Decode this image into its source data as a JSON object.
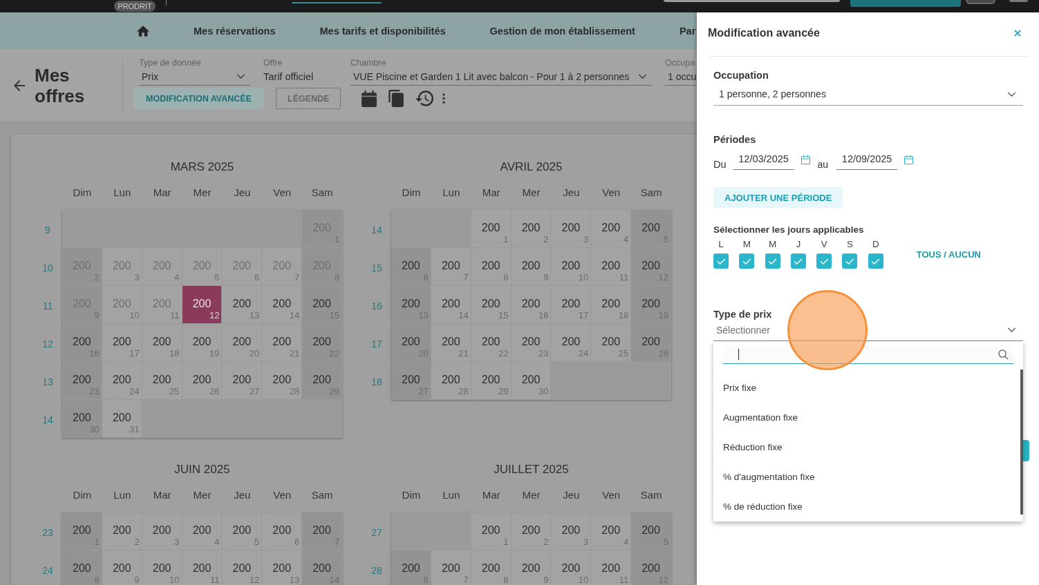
{
  "top_bar": {
    "badge": "PRODRIT"
  },
  "nav": {
    "items": [
      "Mes réservations",
      "Mes tarifs et disponibilités",
      "Gestion de mon établissement",
      "Par"
    ]
  },
  "header": {
    "title": "Mes offres",
    "filters": [
      {
        "kind": "select",
        "label": "Type de donnée",
        "value": "Prix"
      },
      {
        "kind": "text",
        "label": "Offre",
        "value": "Tarif officiel"
      },
      {
        "kind": "select",
        "label": "Chambre",
        "value": "VUE Piscine et Garden 1 Lit avec balcon - Pour 1 à 2 personnes"
      },
      {
        "kind": "partial",
        "label": "Occupa",
        "value": "1 occu"
      }
    ],
    "buttons": [
      {
        "kind": "tonal",
        "label": "MODIFICATION AVANCÉE"
      },
      {
        "kind": "outlined",
        "label": "LÉGENDE"
      }
    ]
  },
  "calendar": {
    "months": [
      {
        "title": "MARS 2025",
        "weekdays": [
          "Dim",
          "Lun",
          "Mar",
          "Mer",
          "Jeu",
          "Ven",
          "Sam"
        ],
        "weeks": [
          {
            "number": "9",
            "days": [
              {
                "kind": "blank"
              },
              {
                "kind": "blank"
              },
              {
                "kind": "blank"
              },
              {
                "kind": "blank"
              },
              {
                "kind": "blank"
              },
              {
                "kind": "blank"
              },
              {
                "kind": "day",
                "price": "200",
                "day": "1",
                "past": true,
                "today": false
              }
            ]
          },
          {
            "number": "10",
            "days": [
              {
                "kind": "day",
                "price": "200",
                "day": "2",
                "past": true,
                "today": false
              },
              {
                "kind": "day",
                "price": "200",
                "day": "3",
                "past": true,
                "today": false
              },
              {
                "kind": "day",
                "price": "200",
                "day": "4",
                "past": true,
                "today": false
              },
              {
                "kind": "day",
                "price": "200",
                "day": "5",
                "past": true,
                "today": false
              },
              {
                "kind": "day",
                "price": "200",
                "day": "6",
                "past": true,
                "today": false
              },
              {
                "kind": "day",
                "price": "200",
                "day": "7",
                "past": true,
                "today": false
              },
              {
                "kind": "day",
                "price": "200",
                "day": "8",
                "past": true,
                "today": false
              }
            ]
          },
          {
            "number": "11",
            "days": [
              {
                "kind": "day",
                "price": "200",
                "day": "9",
                "past": true,
                "today": false
              },
              {
                "kind": "day",
                "price": "200",
                "day": "10",
                "past": true,
                "today": false
              },
              {
                "kind": "day",
                "price": "200",
                "day": "11",
                "past": true,
                "today": false
              },
              {
                "kind": "day",
                "price": "200",
                "day": "12",
                "past": false,
                "today": true
              },
              {
                "kind": "day",
                "price": "200",
                "day": "13",
                "past": false,
                "today": false
              },
              {
                "kind": "day",
                "price": "200",
                "day": "14",
                "past": false,
                "today": false
              },
              {
                "kind": "day",
                "price": "200",
                "day": "15",
                "past": false,
                "today": false
              }
            ]
          },
          {
            "number": "12",
            "days": [
              {
                "kind": "day",
                "price": "200",
                "day": "16",
                "past": false,
                "today": false
              },
              {
                "kind": "day",
                "price": "200",
                "day": "17",
                "past": false,
                "today": false
              },
              {
                "kind": "day",
                "price": "200",
                "day": "18",
                "past": false,
                "today": false
              },
              {
                "kind": "day",
                "price": "200",
                "day": "19",
                "past": false,
                "today": false
              },
              {
                "kind": "day",
                "price": "200",
                "day": "20",
                "past": false,
                "today": false
              },
              {
                "kind": "day",
                "price": "200",
                "day": "21",
                "past": false,
                "today": false
              },
              {
                "kind": "day",
                "price": "200",
                "day": "22",
                "past": false,
                "today": false
              }
            ]
          },
          {
            "number": "13",
            "days": [
              {
                "kind": "day",
                "price": "200",
                "day": "23",
                "past": false,
                "today": false
              },
              {
                "kind": "day",
                "price": "200",
                "day": "24",
                "past": false,
                "today": false
              },
              {
                "kind": "day",
                "price": "200",
                "day": "25",
                "past": false,
                "today": false
              },
              {
                "kind": "day",
                "price": "200",
                "day": "26",
                "past": false,
                "today": false
              },
              {
                "kind": "day",
                "price": "200",
                "day": "27",
                "past": false,
                "today": false
              },
              {
                "kind": "day",
                "price": "200",
                "day": "28",
                "past": false,
                "today": false
              },
              {
                "kind": "day",
                "price": "200",
                "day": "29",
                "past": false,
                "today": false
              }
            ]
          },
          {
            "number": "14",
            "days": [
              {
                "kind": "day",
                "price": "200",
                "day": "30",
                "past": false,
                "today": false
              },
              {
                "kind": "day",
                "price": "200",
                "day": "31",
                "past": false,
                "today": false
              },
              {
                "kind": "blank"
              },
              {
                "kind": "blank"
              },
              {
                "kind": "blank"
              },
              {
                "kind": "blank"
              },
              {
                "kind": "blank"
              }
            ]
          }
        ]
      },
      {
        "title": "AVRIL 2025",
        "weekdays": [
          "Dim",
          "Lun",
          "Mar",
          "Mer",
          "Jeu",
          "Ven",
          "Sam"
        ],
        "weeks": [
          {
            "number": "14",
            "days": [
              {
                "kind": "blank"
              },
              {
                "kind": "blank"
              },
              {
                "kind": "day",
                "price": "200",
                "day": "1",
                "past": false,
                "today": false
              },
              {
                "kind": "day",
                "price": "200",
                "day": "2",
                "past": false,
                "today": false
              },
              {
                "kind": "day",
                "price": "200",
                "day": "3",
                "past": false,
                "today": false
              },
              {
                "kind": "day",
                "price": "200",
                "day": "4",
                "past": false,
                "today": false
              },
              {
                "kind": "day",
                "price": "200",
                "day": "5",
                "past": false,
                "today": false
              }
            ]
          },
          {
            "number": "15",
            "days": [
              {
                "kind": "day",
                "price": "200",
                "day": "6",
                "past": false,
                "today": false
              },
              {
                "kind": "day",
                "price": "200",
                "day": "7",
                "past": false,
                "today": false
              },
              {
                "kind": "day",
                "price": "200",
                "day": "8",
                "past": false,
                "today": false
              },
              {
                "kind": "day",
                "price": "200",
                "day": "9",
                "past": false,
                "today": false
              },
              {
                "kind": "day",
                "price": "200",
                "day": "10",
                "past": false,
                "today": false
              },
              {
                "kind": "day",
                "price": "200",
                "day": "11",
                "past": false,
                "today": false
              },
              {
                "kind": "day",
                "price": "200",
                "day": "12",
                "past": false,
                "today": false
              }
            ]
          },
          {
            "number": "16",
            "days": [
              {
                "kind": "day",
                "price": "200",
                "day": "13",
                "past": false,
                "today": false
              },
              {
                "kind": "day",
                "price": "200",
                "day": "14",
                "past": false,
                "today": false
              },
              {
                "kind": "day",
                "price": "200",
                "day": "15",
                "past": false,
                "today": false
              },
              {
                "kind": "day",
                "price": "200",
                "day": "16",
                "past": false,
                "today": false
              },
              {
                "kind": "day",
                "price": "200",
                "day": "17",
                "past": false,
                "today": false
              },
              {
                "kind": "day",
                "price": "200",
                "day": "18",
                "past": false,
                "today": false
              },
              {
                "kind": "day",
                "price": "200",
                "day": "19",
                "past": false,
                "today": false
              }
            ]
          },
          {
            "number": "17",
            "days": [
              {
                "kind": "day",
                "price": "200",
                "day": "20",
                "past": false,
                "today": false
              },
              {
                "kind": "day",
                "price": "200",
                "day": "21",
                "past": false,
                "today": false
              },
              {
                "kind": "day",
                "price": "200",
                "day": "22",
                "past": false,
                "today": false
              },
              {
                "kind": "day",
                "price": "200",
                "day": "23",
                "past": false,
                "today": false
              },
              {
                "kind": "day",
                "price": "200",
                "day": "24",
                "past": false,
                "today": false
              },
              {
                "kind": "day",
                "price": "200",
                "day": "25",
                "past": false,
                "today": false
              },
              {
                "kind": "day",
                "price": "200",
                "day": "26",
                "past": false,
                "today": false
              }
            ]
          },
          {
            "number": "18",
            "days": [
              {
                "kind": "day",
                "price": "200",
                "day": "27",
                "past": false,
                "today": false
              },
              {
                "kind": "day",
                "price": "200",
                "day": "28",
                "past": false,
                "today": false
              },
              {
                "kind": "day",
                "price": "200",
                "day": "29",
                "past": false,
                "today": false
              },
              {
                "kind": "day",
                "price": "200",
                "day": "30",
                "past": false,
                "today": false
              },
              {
                "kind": "blank"
              },
              {
                "kind": "blank"
              },
              {
                "kind": "blank"
              }
            ]
          }
        ]
      },
      {
        "title": "JUIN 2025",
        "weekdays": [
          "Dim",
          "Lun",
          "Mar",
          "Mer",
          "Jeu",
          "Ven",
          "Sam"
        ],
        "weeks": [
          {
            "number": "23",
            "days": [
              {
                "kind": "day",
                "price": "200",
                "day": "1",
                "past": false,
                "today": false
              },
              {
                "kind": "day",
                "price": "200",
                "day": "2",
                "past": false,
                "today": false
              },
              {
                "kind": "day",
                "price": "200",
                "day": "3",
                "past": false,
                "today": false
              },
              {
                "kind": "day",
                "price": "200",
                "day": "4",
                "past": false,
                "today": false
              },
              {
                "kind": "day",
                "price": "200",
                "day": "5",
                "past": false,
                "today": false
              },
              {
                "kind": "day",
                "price": "200",
                "day": "6",
                "past": false,
                "today": false
              },
              {
                "kind": "day",
                "price": "200",
                "day": "7",
                "past": false,
                "today": false
              }
            ]
          },
          {
            "number": "24",
            "days": [
              {
                "kind": "day",
                "price": "200",
                "day": "8",
                "past": false,
                "today": false
              },
              {
                "kind": "day",
                "price": "200",
                "day": "9",
                "past": false,
                "today": false
              },
              {
                "kind": "day",
                "price": "200",
                "day": "10",
                "past": false,
                "today": false
              },
              {
                "kind": "day",
                "price": "200",
                "day": "11",
                "past": false,
                "today": false
              },
              {
                "kind": "day",
                "price": "200",
                "day": "12",
                "past": false,
                "today": false
              },
              {
                "kind": "day",
                "price": "200",
                "day": "13",
                "past": false,
                "today": false
              },
              {
                "kind": "day",
                "price": "200",
                "day": "14",
                "past": false,
                "today": false
              }
            ]
          }
        ]
      },
      {
        "title": "JUILLET 2025",
        "weekdays": [
          "Dim",
          "Lun",
          "Mar",
          "Mer",
          "Jeu",
          "Ven",
          "Sam"
        ],
        "weeks": [
          {
            "number": "27",
            "days": [
              {
                "kind": "blank"
              },
              {
                "kind": "blank"
              },
              {
                "kind": "day",
                "price": "200",
                "day": "1",
                "past": false,
                "today": false
              },
              {
                "kind": "day",
                "price": "200",
                "day": "2",
                "past": false,
                "today": false
              },
              {
                "kind": "day",
                "price": "200",
                "day": "3",
                "past": false,
                "today": false
              },
              {
                "kind": "day",
                "price": "200",
                "day": "4",
                "past": false,
                "today": false
              },
              {
                "kind": "day",
                "price": "200",
                "day": "5",
                "past": false,
                "today": false
              }
            ]
          },
          {
            "number": "28",
            "days": [
              {
                "kind": "day",
                "price": "200",
                "day": "6",
                "past": false,
                "today": false
              },
              {
                "kind": "day",
                "price": "200",
                "day": "7",
                "past": false,
                "today": false
              },
              {
                "kind": "day",
                "price": "200",
                "day": "8",
                "past": false,
                "today": false
              },
              {
                "kind": "day",
                "price": "200",
                "day": "9",
                "past": false,
                "today": false
              },
              {
                "kind": "day",
                "price": "200",
                "day": "10",
                "past": false,
                "today": false
              },
              {
                "kind": "day",
                "price": "200",
                "day": "11",
                "past": false,
                "today": false
              },
              {
                "kind": "day",
                "price": "200",
                "day": "12",
                "past": false,
                "today": false
              }
            ]
          }
        ]
      }
    ]
  },
  "drawer": {
    "title": "Modification avancée",
    "occupation": {
      "label": "Occupation",
      "value": "1 personne, 2 personnes"
    },
    "periods": {
      "label": "Périodes",
      "from_label": "Du",
      "from": "12/03/2025",
      "to_label": "au",
      "to": "12/09/2025",
      "add_button": "AJOUTER UNE PÉRIODE"
    },
    "weekdays": {
      "label": "Sélectionner les jours applicables",
      "items": [
        {
          "letter": "L",
          "checked": true
        },
        {
          "letter": "M",
          "checked": true
        },
        {
          "letter": "M",
          "checked": true
        },
        {
          "letter": "J",
          "checked": true
        },
        {
          "letter": "V",
          "checked": true
        },
        {
          "letter": "S",
          "checked": true
        },
        {
          "letter": "D",
          "checked": true
        }
      ],
      "toggle_all": "TOUS / AUCUN"
    },
    "price_type": {
      "label": "Type de prix",
      "placeholder": "Sélectionner",
      "expanded": true,
      "options": [
        "Prix fixe",
        "Augmentation fixe",
        "Réduction fixe",
        "% d'augmentation fixe",
        "% de réduction fixe"
      ]
    }
  }
}
